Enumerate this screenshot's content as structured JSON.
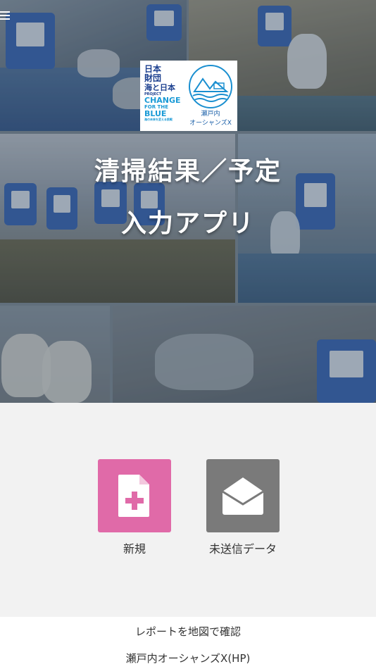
{
  "header": {
    "menu_icon": "hamburger-menu-icon"
  },
  "logos": {
    "nippon_foundation": [
      "日本",
      "財団"
    ],
    "umi_to_nippon": "海と日本",
    "project": "PROJECT",
    "change_for_the_blue": [
      "CHANGE",
      "FOR THE",
      "BLUE"
    ],
    "tagline": "海の未来を変える挑戦",
    "setouchi_name": "瀬戸内",
    "setouchi_sub": "オーシャンズX"
  },
  "hero": {
    "title_line1": "清掃結果／予定",
    "title_line2": "入力アプリ"
  },
  "actions": [
    {
      "label": "新規",
      "icon": "new-document-plus-icon",
      "color": "#e06aa8"
    },
    {
      "label": "未送信データ",
      "icon": "envelope-open-icon",
      "color": "#7a7a7a"
    }
  ],
  "footer": {
    "map_link": "レポートを地図で確認",
    "hp_link": "瀬戸内オーシャンズX(HP)"
  }
}
